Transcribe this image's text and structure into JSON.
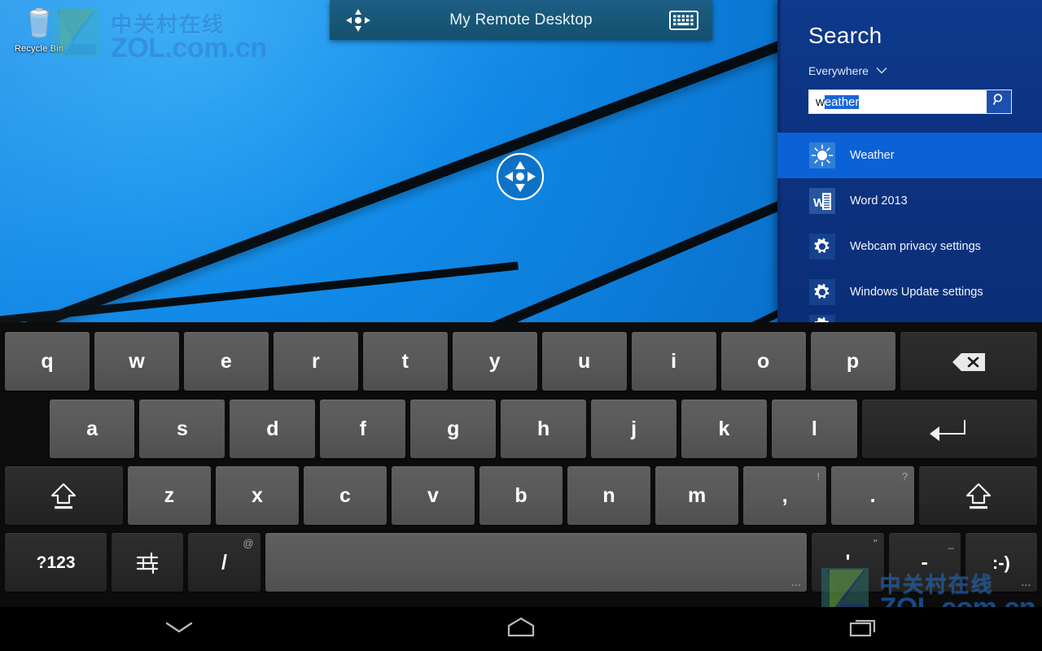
{
  "desktop": {
    "recycle_bin_label": "Recycle Bin",
    "recycle_bin_icon": "recycle-bin-icon",
    "dpad_overlay_icon": "dpad-move-icon"
  },
  "watermark": {
    "cn_text": "中关村在线",
    "en_text": "ZOL.com.cn",
    "logo_icon": "zol-logo-icon"
  },
  "titlebar": {
    "title": "My Remote Desktop",
    "left_icon": "dpad-move-icon",
    "right_icon": "keyboard-icon",
    "background_color": "#185777"
  },
  "search_panel": {
    "heading": "Search",
    "scope_label": "Everywhere",
    "scope_chevron_icon": "chevron-down-icon",
    "input": {
      "typed_text": "w",
      "suggested_text": "eather",
      "full_value": "weather",
      "placeholder": "Search",
      "go_button_icon": "search-icon"
    },
    "accent_color": "#0b62d6",
    "panel_color": "#0c3280",
    "results": [
      {
        "label": "Weather",
        "icon": "sun-weather-icon",
        "selected": true
      },
      {
        "label": "Word 2013",
        "icon": "word-document-icon",
        "selected": false
      },
      {
        "label": "Webcam privacy settings",
        "icon": "gear-icon",
        "selected": false
      },
      {
        "label": "Windows Update settings",
        "icon": "gear-icon",
        "selected": false
      },
      {
        "label": "",
        "icon": "gear-icon",
        "selected": false,
        "partial": true
      }
    ]
  },
  "keyboard": {
    "rows": [
      [
        {
          "label": "q",
          "name": "key-q",
          "style": "unit"
        },
        {
          "label": "w",
          "name": "key-w",
          "style": "unit"
        },
        {
          "label": "e",
          "name": "key-e",
          "style": "unit"
        },
        {
          "label": "r",
          "name": "key-r",
          "style": "unit"
        },
        {
          "label": "t",
          "name": "key-t",
          "style": "unit"
        },
        {
          "label": "y",
          "name": "key-y",
          "style": "unit"
        },
        {
          "label": "u",
          "name": "key-u",
          "style": "unit"
        },
        {
          "label": "i",
          "name": "key-i",
          "style": "unit"
        },
        {
          "label": "o",
          "name": "key-o",
          "style": "unit"
        },
        {
          "label": "p",
          "name": "key-p",
          "style": "unit"
        },
        {
          "label": "",
          "name": "key-backspace",
          "icon": "backspace-icon",
          "style": "wide",
          "dark": true
        }
      ],
      [
        {
          "label": "a",
          "name": "key-a",
          "style": "unit"
        },
        {
          "label": "s",
          "name": "key-s",
          "style": "unit"
        },
        {
          "label": "d",
          "name": "key-d",
          "style": "unit"
        },
        {
          "label": "f",
          "name": "key-f",
          "style": "unit"
        },
        {
          "label": "g",
          "name": "key-g",
          "style": "unit"
        },
        {
          "label": "h",
          "name": "key-h",
          "style": "unit"
        },
        {
          "label": "j",
          "name": "key-j",
          "style": "unit"
        },
        {
          "label": "k",
          "name": "key-k",
          "style": "unit"
        },
        {
          "label": "l",
          "name": "key-l",
          "style": "unit"
        },
        {
          "label": "",
          "name": "key-enter",
          "icon": "enter-icon",
          "style": "enter",
          "dark": true
        }
      ],
      [
        {
          "label": "",
          "name": "key-shift-left",
          "icon": "shift-icon",
          "style": "shift",
          "dark": true
        },
        {
          "label": "z",
          "name": "key-z",
          "style": "unit"
        },
        {
          "label": "x",
          "name": "key-x",
          "style": "unit"
        },
        {
          "label": "c",
          "name": "key-c",
          "style": "unit"
        },
        {
          "label": "v",
          "name": "key-v",
          "style": "unit"
        },
        {
          "label": "b",
          "name": "key-b",
          "style": "unit"
        },
        {
          "label": "n",
          "name": "key-n",
          "style": "unit"
        },
        {
          "label": "m",
          "name": "key-m",
          "style": "unit"
        },
        {
          "label": ",",
          "sup": "!",
          "name": "key-comma",
          "style": "unit"
        },
        {
          "label": ".",
          "sup": "?",
          "name": "key-period",
          "style": "unit"
        },
        {
          "label": "",
          "name": "key-shift-right",
          "icon": "shift-icon",
          "style": "shift",
          "dark": true
        }
      ],
      [
        {
          "label": "?123",
          "name": "key-symbols",
          "style": "shift",
          "dark": true,
          "small": true
        },
        {
          "label": "",
          "name": "key-input-settings",
          "icon": "sliders-icon",
          "style": "unit",
          "dark": true
        },
        {
          "label": "/",
          "sup": "@",
          "name": "key-slash",
          "style": "unit",
          "dark": true
        },
        {
          "label": "",
          "name": "key-space",
          "icon": "space-icon",
          "style": "space",
          "dots": "..."
        },
        {
          "label": "'",
          "sup": "\"",
          "name": "key-apostrophe",
          "style": "unit",
          "dark": true
        },
        {
          "label": "-",
          "sup": "_",
          "name": "key-hyphen",
          "style": "unit",
          "dark": true
        },
        {
          "label": ":-)",
          "name": "key-emoji",
          "style": "unit",
          "dark": true,
          "small": true,
          "dots": "..."
        }
      ]
    ]
  },
  "navbar": {
    "back_icon": "hide-keyboard-chevron-icon",
    "home_icon": "home-icon",
    "recents_icon": "recents-icon"
  }
}
